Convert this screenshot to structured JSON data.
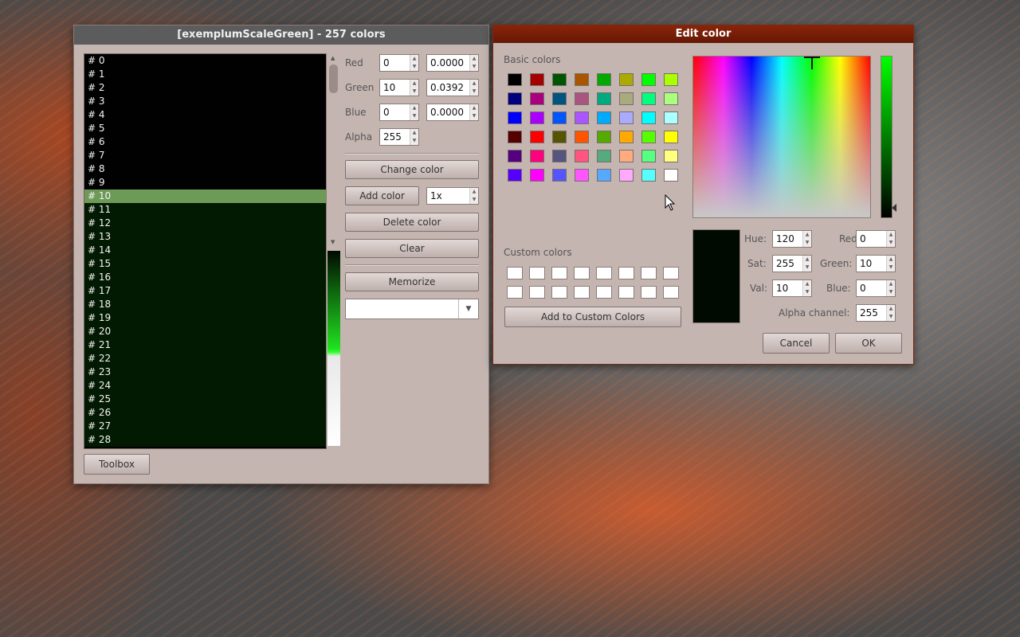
{
  "main_window": {
    "title": "[exemplumScaleGreen] - 257 colors",
    "list_items": [
      "# 0",
      "# 1",
      "# 2",
      "# 3",
      "# 4",
      "# 5",
      "# 6",
      "# 7",
      "# 8",
      "# 9",
      "# 10",
      "# 11",
      "# 12",
      "# 13",
      "# 14",
      "# 15",
      "# 16",
      "# 17",
      "# 18",
      "# 19",
      "# 20",
      "# 21",
      "# 22",
      "# 23",
      "# 24",
      "# 25",
      "# 26",
      "# 27",
      "# 28"
    ],
    "selected_index": 10,
    "channels": {
      "red_label": "Red",
      "red_value": "0",
      "red_float": "0.0000",
      "green_label": "Green",
      "green_value": "10",
      "green_float": "0.0392",
      "blue_label": "Blue",
      "blue_value": "0",
      "blue_float": "0.0000",
      "alpha_label": "Alpha",
      "alpha_value": "255"
    },
    "buttons": {
      "change_color": "Change color",
      "add_color": "Add color",
      "delete_color": "Delete color",
      "clear": "Clear",
      "memorize": "Memorize",
      "toolbox": "Toolbox"
    },
    "multiplier_value": "1x",
    "memorize_dropdown_value": ""
  },
  "dialog": {
    "title": "Edit color",
    "basic_colors_label": "Basic colors",
    "custom_colors_label": "Custom colors",
    "add_custom_button": "Add to Custom Colors",
    "basic_colors": [
      [
        "#000000",
        "#a50000",
        "#005500",
        "#aa5500",
        "#00aa00",
        "#aaaa00",
        "#00ff00",
        "#aaff00"
      ],
      [
        "#00007f",
        "#aa007f",
        "#00557f",
        "#aa557f",
        "#00aa7f",
        "#aaaa7f",
        "#00ff7f",
        "#aaff7f"
      ],
      [
        "#0000ff",
        "#aa00ff",
        "#0055ff",
        "#aa55ff",
        "#00aaff",
        "#aaaaff",
        "#00ffff",
        "#aaffff"
      ],
      [
        "#550000",
        "#ff0000",
        "#555500",
        "#ff5500",
        "#55aa00",
        "#ffaa00",
        "#55ff00",
        "#ffff00"
      ],
      [
        "#55007f",
        "#ff007f",
        "#55557f",
        "#ff557f",
        "#55aa7f",
        "#ffaa7f",
        "#55ff7f",
        "#ffff7f"
      ],
      [
        "#5500ff",
        "#ff00ff",
        "#5555ff",
        "#ff55ff",
        "#55aaff",
        "#ffaaff",
        "#55ffff",
        "#ffffff"
      ]
    ],
    "hue_label": "Hue:",
    "hue_value": "120",
    "sat_label": "Sat:",
    "sat_value": "255",
    "val_label": "Val:",
    "val_value": "10",
    "red_label": "Red:",
    "red_value": "0",
    "green_label": "Green:",
    "green_value": "10",
    "blue_label": "Blue:",
    "blue_value": "0",
    "alpha_label": "Alpha channel:",
    "alpha_value": "255",
    "cancel_button": "Cancel",
    "ok_button": "OK",
    "current_color": "#010a00"
  }
}
